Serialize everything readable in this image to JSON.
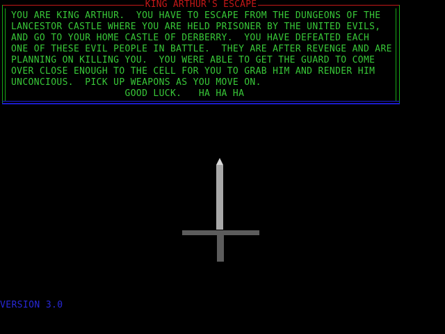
{
  "intro": {
    "title": "KING ARTHUR'S ESCAPE",
    "lines": [
      "YOU ARE KING ARTHUR.  YOU HAVE TO ESCAPE FROM THE DUNGEONS OF THE",
      "LANCESTOR CASTLE WHERE YOU ARE HELD PRISONER BY THE UNITED EVILS,",
      "AND GO TO YOUR HOME CASTLE OF DERBERRY.  YOU HAVE DEFEATED EACH",
      "ONE OF THESE EVIL PEOPLE IN BATTLE.  THEY ARE AFTER REVENGE AND ARE",
      "PLANNING ON KILLING YOU.  YOU WERE ABLE TO GET THE GUARD TO COME",
      "OVER CLOSE ENOUGH TO THE CELL FOR YOU TO GRAB HIM AND RENDER HIM",
      "UNCONCIOUS.  PICK UP WEAPONS AS YOU MOVE ON.",
      "                    GOOD LUCK.   HA HA HA"
    ]
  },
  "footer": {
    "version": "VERSION 3.0"
  },
  "colors": {
    "background": "#000000",
    "title_text": "#c41818",
    "top_border": "#c41818",
    "side_borders": "#18a818",
    "bottom_border": "#1c1ccc",
    "story_text": "#38c838",
    "version_text": "#2828d8",
    "sword_blade": "#a8a8a8",
    "sword_tip": "#d8d8d8",
    "sword_guard": "#5c5c5c",
    "sword_hilt": "#5c5c5c"
  },
  "sprite": {
    "name": "sword-icon"
  }
}
